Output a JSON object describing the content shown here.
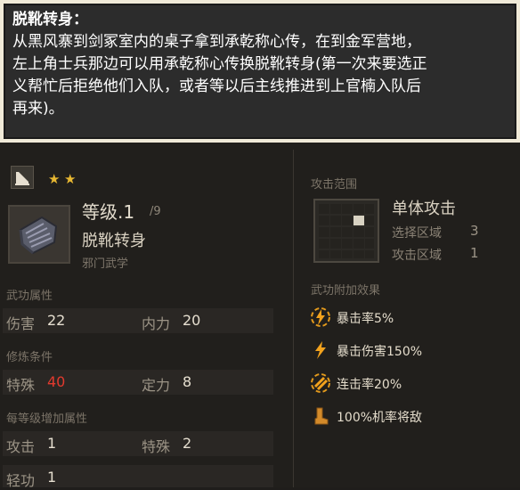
{
  "banner": {
    "title": "脱靴转身：",
    "lines": [
      "从黑风寨到剑冢室内的桌子拿到承乾称心传，在到金军营地，",
      "左上角士兵那边可以用承乾称心传换脱靴转身(第一次来要选正",
      "义帮忙后拒绝他们入队，或者等以后主线推进到上官楠入队后",
      "再来)。"
    ]
  },
  "skill": {
    "stars": [
      "★",
      "★"
    ],
    "level_prefix": "等级.1",
    "level_max": "/9",
    "name": "脱靴转身",
    "school": "邪门武学"
  },
  "attributes": {
    "header": "武功属性",
    "damage_label": "伤害",
    "damage_value": "22",
    "inner_label": "内力",
    "inner_value": "20"
  },
  "requirements": {
    "header": "修炼条件",
    "special_label": "特殊",
    "special_value": "40",
    "focus_label": "定力",
    "focus_value": "8"
  },
  "per_level": {
    "header": "每等级增加属性",
    "attack_label": "攻击",
    "attack_value": "1",
    "special_label": "特殊",
    "special_value": "2",
    "agility_label": "轻功",
    "agility_value": "1"
  },
  "range": {
    "header": "攻击范围",
    "title": "单体攻击",
    "select_label": "选择区域",
    "select_value": "3",
    "attack_label": "攻击区域",
    "attack_value": "1"
  },
  "effects": {
    "header": "武功附加效果",
    "items": [
      {
        "icon": "crit-rate-icon",
        "text": "暴击率5%"
      },
      {
        "icon": "crit-damage-icon",
        "text": "暴击伤害150%"
      },
      {
        "icon": "combo-rate-icon",
        "text": "连击率20%"
      },
      {
        "icon": "boot-icon",
        "text": "100%机率将敌"
      }
    ]
  },
  "colors": {
    "accent_gold": "#e8b832",
    "unmet_red": "#e23a2e"
  }
}
